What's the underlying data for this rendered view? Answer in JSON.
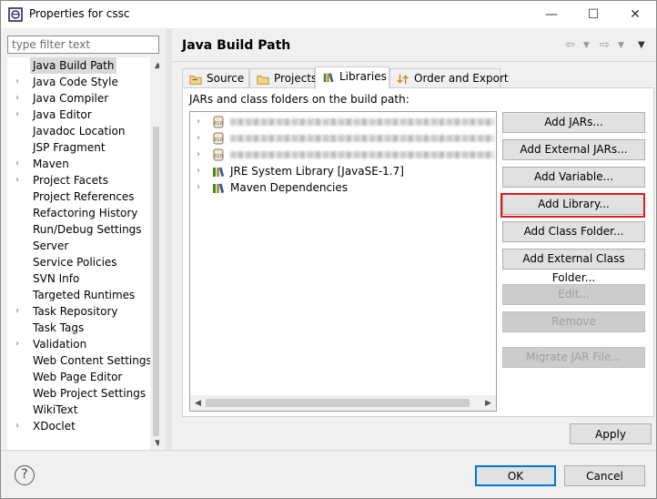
{
  "window": {
    "title": "Properties for cssc",
    "controls": {
      "minimize": "—",
      "maximize": "☐",
      "close": "✕"
    }
  },
  "filter": {
    "placeholder": "type filter text"
  },
  "tree": {
    "items": [
      {
        "label": "Java Build Path",
        "expandable": false,
        "selected": true
      },
      {
        "label": "Java Code Style",
        "expandable": true
      },
      {
        "label": "Java Compiler",
        "expandable": true
      },
      {
        "label": "Java Editor",
        "expandable": true
      },
      {
        "label": "Javadoc Location",
        "expandable": false
      },
      {
        "label": "JSP Fragment",
        "expandable": false
      },
      {
        "label": "Maven",
        "expandable": true
      },
      {
        "label": "Project Facets",
        "expandable": true
      },
      {
        "label": "Project References",
        "expandable": false
      },
      {
        "label": "Refactoring History",
        "expandable": false
      },
      {
        "label": "Run/Debug Settings",
        "expandable": false
      },
      {
        "label": "Server",
        "expandable": false
      },
      {
        "label": "Service Policies",
        "expandable": false
      },
      {
        "label": "SVN Info",
        "expandable": false
      },
      {
        "label": "Targeted Runtimes",
        "expandable": false
      },
      {
        "label": "Task Repository",
        "expandable": true
      },
      {
        "label": "Task Tags",
        "expandable": false
      },
      {
        "label": "Validation",
        "expandable": true
      },
      {
        "label": "Web Content Settings",
        "expandable": false
      },
      {
        "label": "Web Page Editor",
        "expandable": false
      },
      {
        "label": "Web Project Settings",
        "expandable": false
      },
      {
        "label": "WikiText",
        "expandable": false
      },
      {
        "label": "XDoclet",
        "expandable": true
      }
    ]
  },
  "page": {
    "title": "Java Build Path"
  },
  "tabs": [
    {
      "label": "Source",
      "icon": "source-folder-icon",
      "active": false
    },
    {
      "label": "Projects",
      "icon": "projects-folder-icon",
      "active": false
    },
    {
      "label": "Libraries",
      "icon": "libraries-icon",
      "active": true
    },
    {
      "label": "Order and Export",
      "icon": "order-export-icon",
      "active": false
    }
  ],
  "libraries": {
    "section_label": "JARs and class folders on the build path:",
    "entries": [
      {
        "label": "",
        "icon": "jar-icon",
        "blurred": true
      },
      {
        "label": "",
        "icon": "jar-icon",
        "blurred": true
      },
      {
        "label": "",
        "icon": "jar-icon",
        "blurred": true
      },
      {
        "label": "JRE System Library [JavaSE-1.7]",
        "icon": "library-icon",
        "blurred": false
      },
      {
        "label": "Maven Dependencies",
        "icon": "library-icon",
        "blurred": false
      }
    ]
  },
  "buttons": {
    "add_jars": "Add JARs...",
    "add_external_jars": "Add External JARs...",
    "add_variable": "Add Variable...",
    "add_library": "Add Library...",
    "add_class_folder": "Add Class Folder...",
    "add_external_class_folder": "Add External Class Folder...",
    "edit": "Edit...",
    "remove": "Remove",
    "migrate_jar": "Migrate JAR File...",
    "apply": "Apply",
    "ok": "OK",
    "cancel": "Cancel"
  },
  "colors": {
    "highlight": "#e21a1a",
    "default_button_border": "#0078d7"
  }
}
